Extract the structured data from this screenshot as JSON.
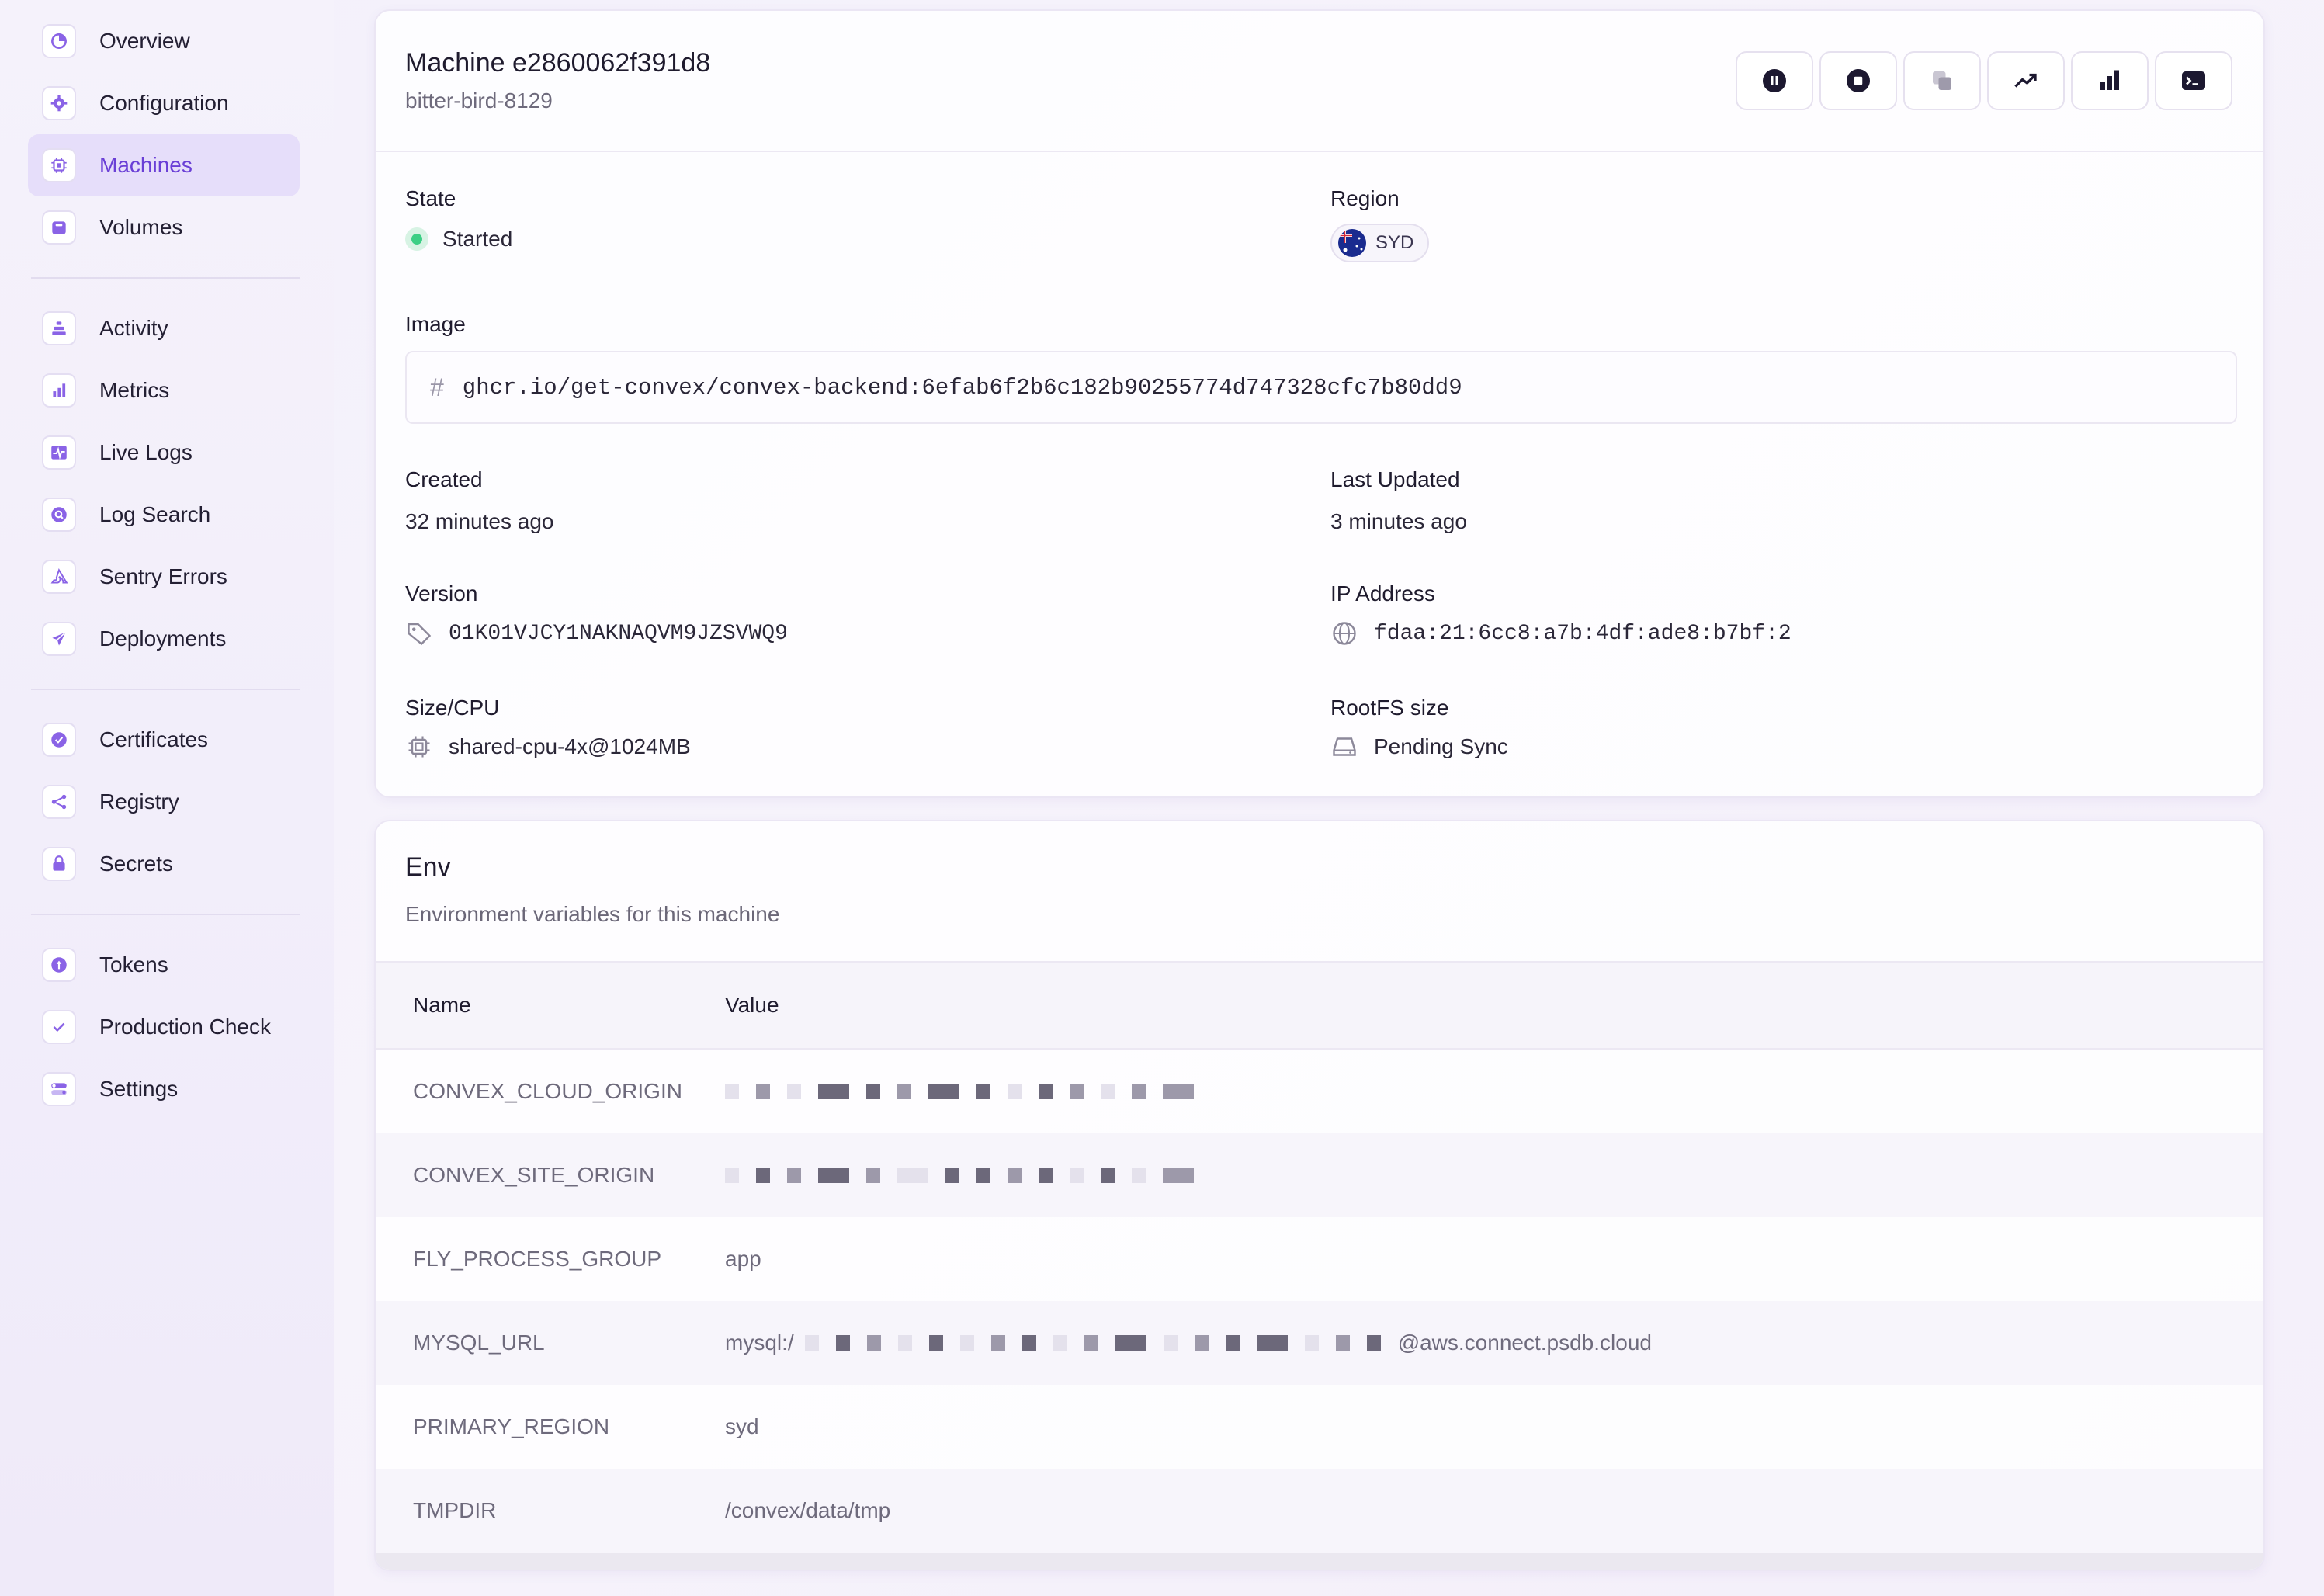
{
  "sidebar": {
    "groups": [
      [
        {
          "label": "Overview",
          "icon": "overview-icon"
        },
        {
          "label": "Configuration",
          "icon": "gear-icon"
        },
        {
          "label": "Machines",
          "icon": "chip-icon",
          "active": true
        },
        {
          "label": "Volumes",
          "icon": "volume-icon"
        }
      ],
      [
        {
          "label": "Activity",
          "icon": "activity-icon"
        },
        {
          "label": "Metrics",
          "icon": "bar-chart-icon"
        },
        {
          "label": "Live Logs",
          "icon": "pulse-icon"
        },
        {
          "label": "Log Search",
          "icon": "search-icon"
        },
        {
          "label": "Sentry Errors",
          "icon": "sentry-icon"
        },
        {
          "label": "Deployments",
          "icon": "rocket-icon"
        }
      ],
      [
        {
          "label": "Certificates",
          "icon": "certificate-icon"
        },
        {
          "label": "Registry",
          "icon": "registry-icon"
        },
        {
          "label": "Secrets",
          "icon": "lock-icon"
        }
      ],
      [
        {
          "label": "Tokens",
          "icon": "token-icon"
        },
        {
          "label": "Production Check",
          "icon": "check-icon"
        },
        {
          "label": "Settings",
          "icon": "toggle-icon"
        }
      ]
    ],
    "accent_color": "#6a3fd6"
  },
  "machine": {
    "title": "Machine e2860062f391d8",
    "name": "bitter-bird-8129",
    "actions": [
      "pause-icon",
      "stop-icon",
      "clone-icon",
      "trend-icon",
      "metrics-icon",
      "terminal-icon"
    ],
    "state_label": "State",
    "state_value": "Started",
    "state_color": "#3ccf85",
    "region_label": "Region",
    "region_value": "SYD",
    "image_label": "Image",
    "image_hash": "#",
    "image_value": "ghcr.io/get-convex/convex-backend:6efab6f2b6c182b90255774d747328cfc7b80dd9",
    "created_label": "Created",
    "created_value": "32 minutes ago",
    "updated_label": "Last Updated",
    "updated_value": "3 minutes ago",
    "version_label": "Version",
    "version_value": "01K01VJCY1NAKNAQVM9JZSVWQ9",
    "ip_label": "IP Address",
    "ip_value": "fdaa:21:6cc8:a7b:4df:ade8:b7bf:2",
    "size_label": "Size/CPU",
    "size_value": "shared-cpu-4x@1024MB",
    "rootfs_label": "RootFS size",
    "rootfs_value": "Pending Sync"
  },
  "env": {
    "title": "Env",
    "description": "Environment variables for this machine",
    "col_name": "Name",
    "col_value": "Value",
    "rows": [
      {
        "name": "CONVEX_CLOUD_ORIGIN",
        "value": "",
        "redacted": true
      },
      {
        "name": "CONVEX_SITE_ORIGIN",
        "value": "",
        "redacted": true
      },
      {
        "name": "FLY_PROCESS_GROUP",
        "value": "app"
      },
      {
        "name": "MYSQL_URL",
        "value_prefix": "mysql:/",
        "value_suffix": "@aws.connect.psdb.cloud",
        "redacted": true
      },
      {
        "name": "PRIMARY_REGION",
        "value": "syd"
      },
      {
        "name": "TMPDIR",
        "value": "/convex/data/tmp"
      }
    ]
  }
}
